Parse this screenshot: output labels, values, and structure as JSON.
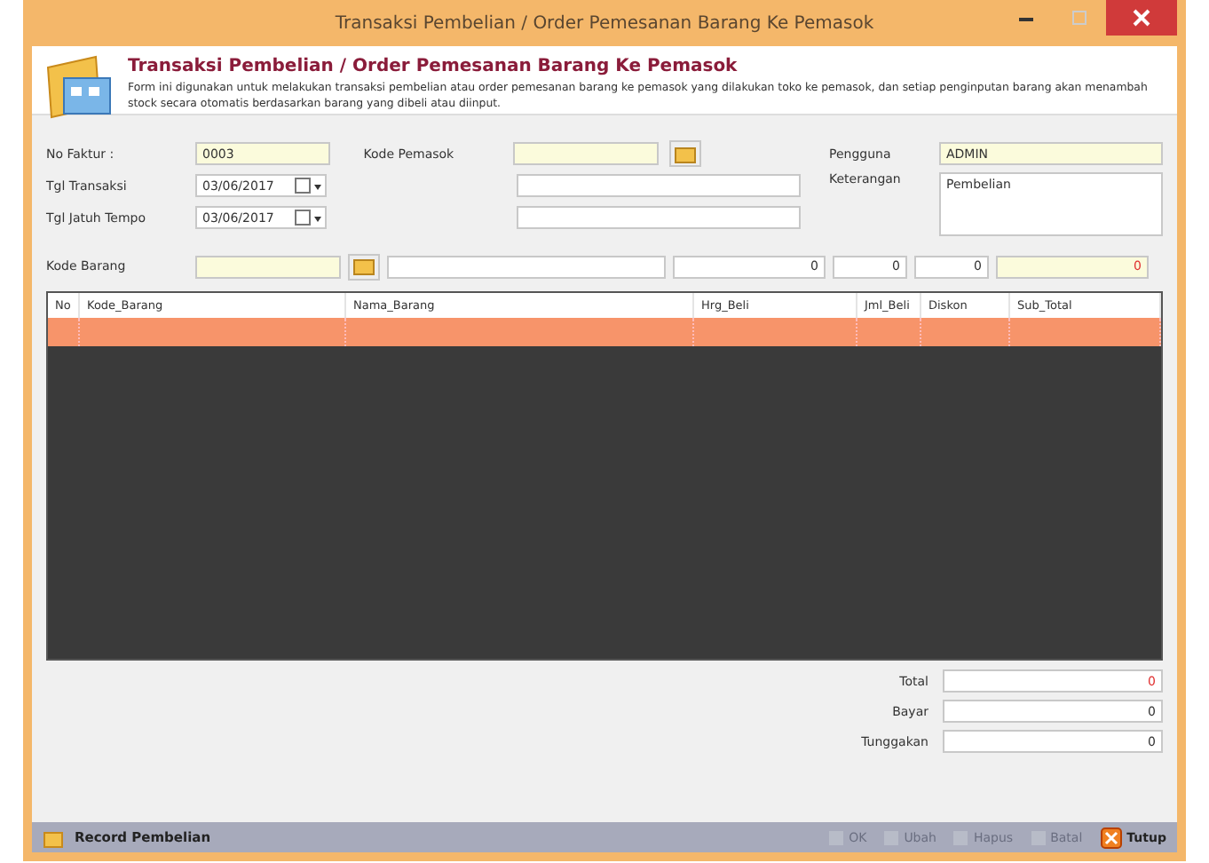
{
  "window": {
    "title": "Transaksi Pembelian / Order Pemesanan Barang Ke Pemasok"
  },
  "header": {
    "title": "Transaksi Pembelian / Order Pemesanan Barang Ke Pemasok",
    "description": "Form ini digunakan untuk melakukan transaksi pembelian atau order pemesanan barang ke pemasok yang dilakukan toko ke pemasok, dan setiap penginputan barang akan menambah stock secara otomatis berdasarkan barang yang dibeli atau diinput."
  },
  "form": {
    "no_faktur": {
      "label": "No Faktur :",
      "value": "0003"
    },
    "tgl_transaksi": {
      "label": "Tgl Transaksi",
      "value": "03/06/2017"
    },
    "tgl_jatuh_tempo": {
      "label": "Tgl Jatuh Tempo",
      "value": "03/06/2017"
    },
    "kode_pemasok": {
      "label": "Kode Pemasok"
    },
    "pengguna": {
      "label": "Pengguna",
      "value": "ADMIN"
    },
    "keterangan": {
      "label": "Keterangan",
      "value": "Pembelian"
    },
    "kode_barang": {
      "label": "Kode Barang"
    },
    "harga": "0",
    "jumlah": "0",
    "diskon": "0",
    "sub_total": "0"
  },
  "table": {
    "columns": [
      "No",
      "Kode_Barang",
      "Nama_Barang",
      "Hrg_Beli",
      "Jml_Beli",
      "Diskon",
      "Sub_Total"
    ],
    "rows": [
      {
        "selected": true
      }
    ]
  },
  "totals": [
    {
      "label": "Total",
      "value": "0",
      "kind": "highlight"
    },
    {
      "label": "Bayar",
      "value": "0",
      "kind": "plain"
    },
    {
      "label": "Tunggakan",
      "value": "0",
      "kind": "plain"
    }
  ],
  "status_bar": {
    "title": "Record Pembelian",
    "buttons": [
      {
        "label": "OK",
        "disabled": true
      },
      {
        "label": "Ubah",
        "disabled": true
      },
      {
        "label": "Hapus",
        "disabled": true
      },
      {
        "label": "Batal",
        "disabled": true
      },
      {
        "label": "Tutup",
        "disabled": false
      }
    ]
  }
}
